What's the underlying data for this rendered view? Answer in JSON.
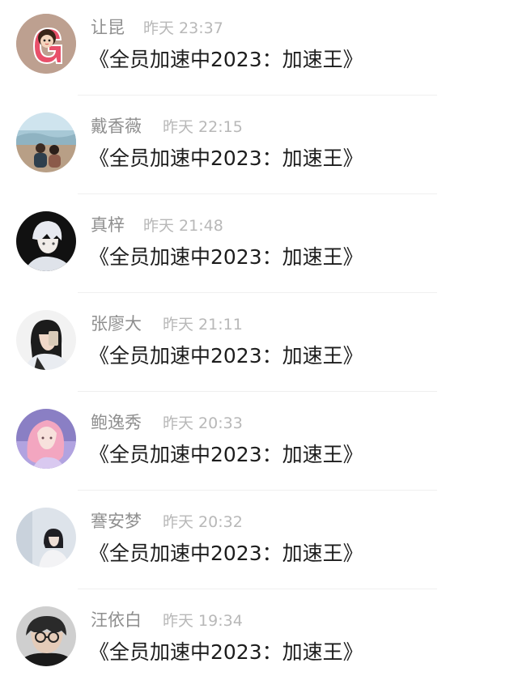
{
  "comments": [
    {
      "name": "让昆",
      "time": "昨天 23:37",
      "text": "《全员加速中2023：加速王》",
      "avatar_icon": "cartoon-girl-avatar-icon"
    },
    {
      "name": "戴香薇",
      "time": "昨天 22:15",
      "text": "《全员加速中2023：加速王》",
      "avatar_icon": "couple-photo-avatar-icon"
    },
    {
      "name": "真梓",
      "time": "昨天 21:48",
      "text": "《全员加速中2023：加速王》",
      "avatar_icon": "anime-boy-avatar-icon"
    },
    {
      "name": "张廖大",
      "time": "昨天 21:11",
      "text": "《全员加速中2023：加速王》",
      "avatar_icon": "selfie-girl-avatar-icon"
    },
    {
      "name": "鲍逸秀",
      "time": "昨天 20:33",
      "text": "《全员加速中2023：加速王》",
      "avatar_icon": "pink-hair-girl-avatar-icon"
    },
    {
      "name": "謇安梦",
      "time": "昨天 20:32",
      "text": "《全员加速中2023：加速王》",
      "avatar_icon": "sitting-girl-avatar-icon"
    },
    {
      "name": "汪依白",
      "time": "昨天 19:34",
      "text": "《全员加速中2023：加速王》",
      "avatar_icon": "glasses-man-avatar-icon"
    }
  ]
}
